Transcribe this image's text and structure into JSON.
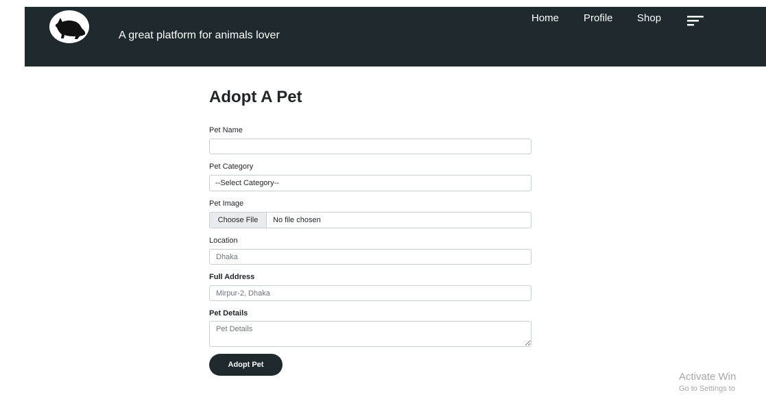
{
  "header": {
    "tagline": "A great platform for animals lover",
    "nav": {
      "home": "Home",
      "profile": "Profile",
      "shop": "Shop"
    },
    "logo_icon": "cat-silhouette-icon",
    "menu_icon": "menu-icon"
  },
  "form": {
    "title": "Adopt A Pet",
    "pet_name": {
      "label": "Pet Name",
      "value": "",
      "placeholder": ""
    },
    "pet_category": {
      "label": "Pet Category",
      "selected": "--Select Category--"
    },
    "pet_image": {
      "label": "Pet Image",
      "button": "Choose File",
      "status": "No file chosen"
    },
    "location": {
      "label": "Location",
      "value": "",
      "placeholder": "Dhaka"
    },
    "full_address": {
      "label": "Full Address",
      "value": "",
      "placeholder": "Mirpur-2, Dhaka"
    },
    "pet_details": {
      "label": "Pet Details",
      "value": "",
      "placeholder": "Pet Details"
    },
    "submit_label": "Adopt Pet"
  },
  "watermark": {
    "line1": "Activate Win",
    "line2": "Go to Settings to"
  },
  "colors": {
    "header_bg": "#1f2a2e",
    "button_bg": "#1f2a2e",
    "watermark": "#a7a7a7"
  }
}
